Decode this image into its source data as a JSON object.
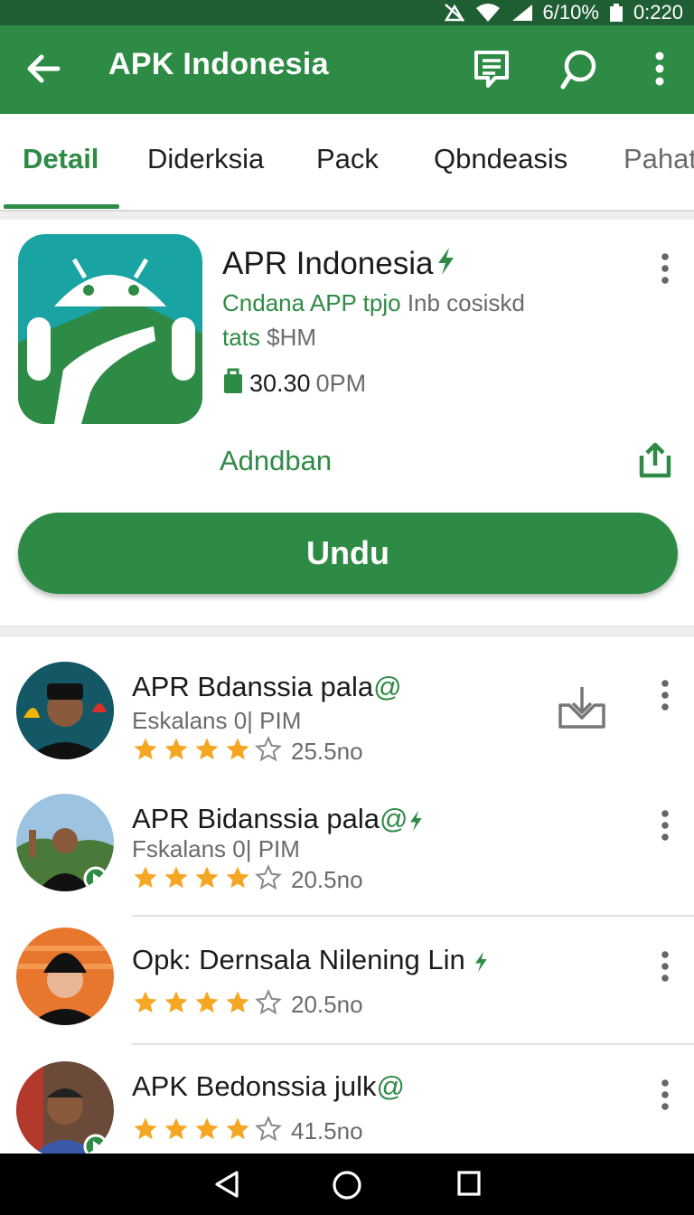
{
  "status_bar": {
    "battery": "6/10%",
    "time": "0:220"
  },
  "app_bar": {
    "title": "APK Indonesia"
  },
  "tabs": [
    {
      "label": "Detail",
      "active": true
    },
    {
      "label": "Diderksia",
      "active": false
    },
    {
      "label": "Pack",
      "active": false
    },
    {
      "label": "Qbndeasis",
      "active": false
    },
    {
      "label": "Pahat",
      "active": false
    }
  ],
  "app": {
    "name": "APR Indonesia",
    "subtitle_green": "Cndana APP tpjo",
    "subtitle_gray": "Inb cosiskd",
    "subtitle2_green": "tats",
    "subtitle2_gray": "$HM",
    "size_value": "30.30",
    "size_unit": "0PM",
    "link_label": "Adndban",
    "install_label": "Undu"
  },
  "list": [
    {
      "title": "APR Bdanssia pala",
      "subtitle": "Eskalans 0| PIM",
      "rating": 4,
      "count": "25.5no"
    },
    {
      "title": "APR Bidanssia pala",
      "subtitle": "Fskalans 0| PIM",
      "rating": 4,
      "count": "20.5no"
    },
    {
      "title": "Opk: Dernsala Nilening Lin",
      "subtitle": "",
      "rating": 4,
      "count": "20.5no"
    },
    {
      "title": "APK Bedonssia julk",
      "subtitle": "",
      "rating": 4,
      "count": "41.5no"
    }
  ],
  "colors": {
    "brand": "#2e8b45",
    "status_bar": "#1f5e33",
    "star": "#f5a623"
  }
}
